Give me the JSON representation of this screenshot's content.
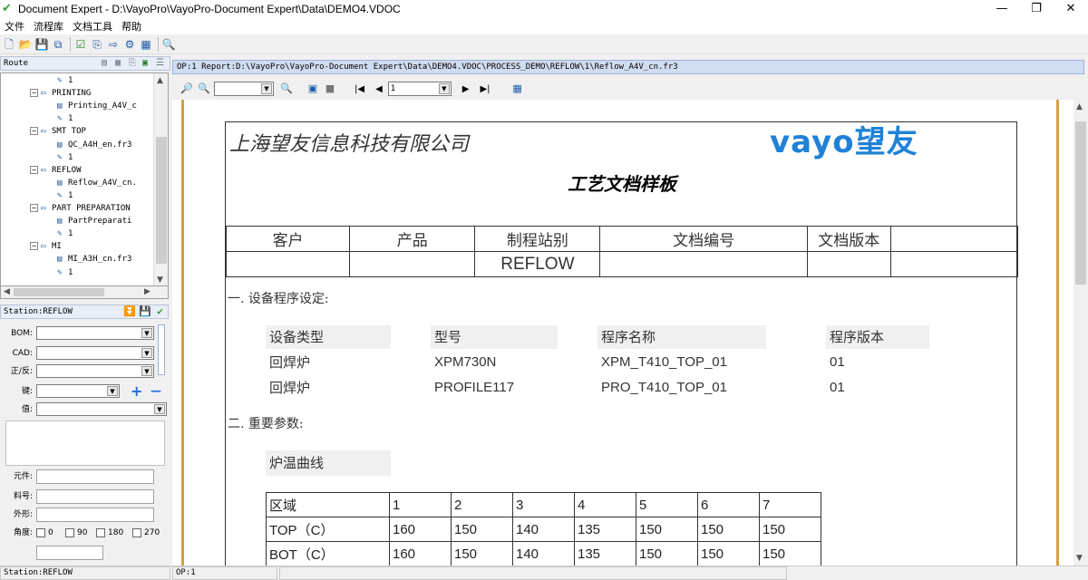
{
  "window": {
    "title": "Document Expert - D:\\VayoPro\\VayoPro-Document Expert\\Data\\DEMO4.VDOC",
    "min": "—",
    "max": "❐",
    "close": "✕"
  },
  "menu": [
    "文件",
    "流程库",
    "文档工具",
    "帮助"
  ],
  "route": {
    "header": "Route",
    "tree": [
      {
        "indent": 3,
        "type": "leaf",
        "text": "1"
      },
      {
        "indent": 2,
        "type": "node",
        "text": "PRINTING"
      },
      {
        "indent": 3,
        "type": "doc",
        "text": "Printing_A4V_c"
      },
      {
        "indent": 3,
        "type": "leaf",
        "text": "1"
      },
      {
        "indent": 2,
        "type": "node",
        "text": "SMT TOP"
      },
      {
        "indent": 3,
        "type": "doc",
        "text": "QC_A4H_en.fr3"
      },
      {
        "indent": 3,
        "type": "leaf",
        "text": "1"
      },
      {
        "indent": 2,
        "type": "node",
        "text": "REFLOW"
      },
      {
        "indent": 3,
        "type": "doc",
        "text": "Reflow_A4V_cn."
      },
      {
        "indent": 3,
        "type": "leaf",
        "text": "1"
      },
      {
        "indent": 2,
        "type": "node",
        "text": "PART PREPARATION"
      },
      {
        "indent": 3,
        "type": "doc",
        "text": "PartPreparati"
      },
      {
        "indent": 3,
        "type": "leaf",
        "text": "1"
      },
      {
        "indent": 2,
        "type": "node",
        "text": "MI"
      },
      {
        "indent": 3,
        "type": "doc",
        "text": "MI_A3H_cn.fr3"
      },
      {
        "indent": 3,
        "type": "leaf",
        "text": "1"
      }
    ]
  },
  "station": {
    "header": "Station:REFLOW",
    "labels": {
      "bom": "BOM:",
      "cad": "CAD:",
      "side": "正/反:",
      "key": "键:",
      "value": "值:",
      "part": "元件:",
      "pn": "料号:",
      "shape": "外形:",
      "angle": "角度:"
    },
    "angles": [
      "0",
      "90",
      "180",
      "270"
    ],
    "add": "+",
    "remove": "—"
  },
  "main": {
    "op_header": "OP:1    Report:D:\\VayoPro\\VayoPro-Document Expert\\Data\\DEMO4.VDOC\\PROCESS_DEMO\\REFLOW\\1\\Reflow_A4V_cn.fr3",
    "page_value": "1"
  },
  "document": {
    "company": "上海望友信息科技有限公司",
    "brand": "vayo望友",
    "title": "工艺文档样板",
    "header_cols": [
      "客户",
      "产品",
      "制程站别",
      "文档编号",
      "文档版本",
      ""
    ],
    "header_values": [
      "",
      "",
      "REFLOW",
      "",
      "",
      ""
    ],
    "section1": "一. 设备程序设定:",
    "prog_headers": [
      "设备类型",
      "型号",
      "程序名称",
      "程序版本"
    ],
    "prog_rows": [
      [
        "回焊炉",
        "XPM730N",
        "XPM_T410_TOP_01",
        "01"
      ],
      [
        "回焊炉",
        "PROFILE117",
        "PRO_T410_TOP_01",
        "01"
      ]
    ],
    "section2": "二. 重要参数:",
    "curve_label": "炉温曲线",
    "zone_rows": [
      [
        "区域",
        "1",
        "2",
        "3",
        "4",
        "5",
        "6",
        "7"
      ],
      [
        "TOP（C）",
        "160",
        "150",
        "140",
        "135",
        "150",
        "150",
        "150"
      ],
      [
        "BOT（C）",
        "160",
        "150",
        "140",
        "135",
        "150",
        "150",
        "150"
      ]
    ]
  },
  "status": {
    "station": "Station:REFLOW",
    "op": "OP:1"
  }
}
